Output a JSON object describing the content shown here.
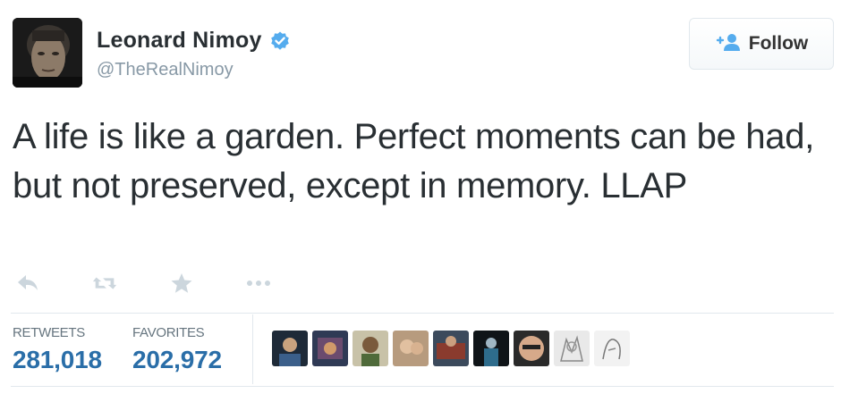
{
  "author": {
    "display_name": "Leonard Nimoy",
    "handle": "@TheRealNimoy",
    "verified": true
  },
  "follow_button": {
    "label": "Follow",
    "icon": "add-user-icon"
  },
  "tweet": {
    "text": "A life is like a garden. Perfect moments can be had, but not preserved, except in memory.  LLAP"
  },
  "actions": [
    "reply-icon",
    "retweet-icon",
    "favorite-icon",
    "more-icon"
  ],
  "stats": {
    "retweets_label": "RETWEETS",
    "retweets_value": "281,018",
    "favorites_label": "FAVORITES",
    "favorites_value": "202,972"
  },
  "colors": {
    "link_blue": "#2a6ea8",
    "verified_blue": "#55acee",
    "muted_gray": "#8899a6",
    "action_gray": "#ccd6dd",
    "divider": "#e1e8ed"
  }
}
